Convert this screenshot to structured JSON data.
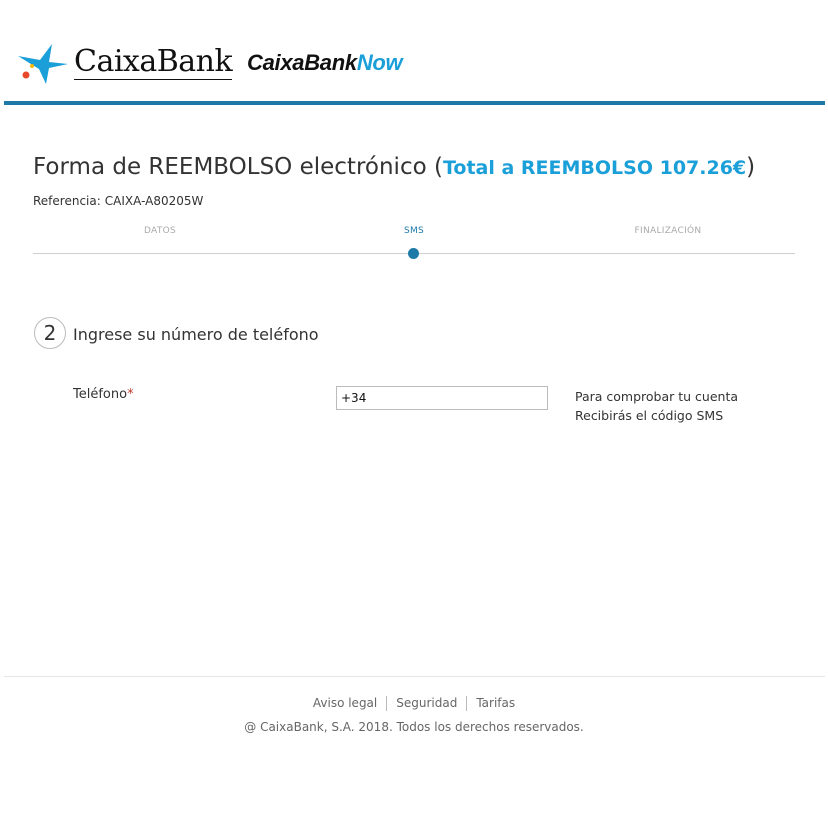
{
  "header": {
    "brand_logo_text": "CaixaBank",
    "brand_now_prefix": "CaixaBank",
    "brand_now_suffix": "Now",
    "accent_color": "#1a9fd9",
    "line_color": "#1d7aa6"
  },
  "page": {
    "title": "Forma de REEMBOLSO electrónico",
    "title_paren_open": "(",
    "total_label": "Total a REEMBOLSO 107.26€",
    "title_paren_close": ")",
    "reference_label": "Referencia:",
    "reference_value": "CAIXA-A80205W"
  },
  "steps": {
    "items": [
      {
        "label": "DATOS",
        "active": false
      },
      {
        "label": "SMS",
        "active": true
      },
      {
        "label": "FINALIZACIÓN",
        "active": false
      }
    ]
  },
  "section": {
    "number": "2",
    "heading": "Ingrese su número de teléfono"
  },
  "form": {
    "phone_label": "Teléfono",
    "required_marker": "*",
    "phone_value": "+34",
    "help_line1": "Para comprobar tu cuenta",
    "help_line2": "Recibirás el código SMS"
  },
  "footer": {
    "links": [
      "Aviso legal",
      "Seguridad",
      "Tarifas"
    ],
    "copyright": "@ CaixaBank, S.A. 2018. Todos los derechos reservados."
  }
}
